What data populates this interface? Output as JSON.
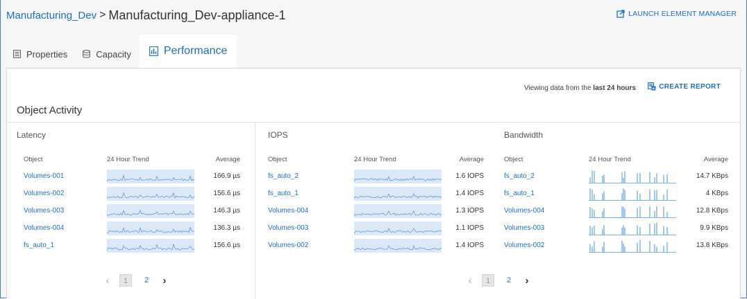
{
  "header": {
    "breadcrumb_link": "Manufacturing_Dev",
    "separator": ">",
    "title": "Manufacturing_Dev-appliance-1",
    "launch_label": "LAUNCH ELEMENT MANAGER"
  },
  "tabs": [
    {
      "label": "Properties",
      "icon": "list-icon"
    },
    {
      "label": "Capacity",
      "icon": "database-icon"
    },
    {
      "label": "Performance",
      "icon": "bar-chart-icon",
      "active": true
    }
  ],
  "toolbar": {
    "viewing_prefix": "Viewing data from the",
    "viewing_range": "last 24 hours",
    "create_report": "CREATE REPORT"
  },
  "section_title": "Object Activity",
  "colors": {
    "link": "#1e6fc6",
    "spark_bg": "#dbe8f7",
    "spark_line": "#4f8fd6",
    "bar": "#7ab0e8"
  },
  "latency": {
    "title": "Latency",
    "columns": {
      "object": "Object",
      "trend": "24 Hour Trend",
      "average": "Average"
    },
    "rows": [
      {
        "object": "Volumes-001",
        "average": "166.9 µs"
      },
      {
        "object": "Volumes-002",
        "average": "156.6 µs"
      },
      {
        "object": "Volumes-003",
        "average": "146.3 µs"
      },
      {
        "object": "Volumes-004",
        "average": "136.3 µs"
      },
      {
        "object": "fs_auto_1",
        "average": "156.6 µs"
      }
    ],
    "pagination": {
      "prev": "‹",
      "current": "1",
      "next_page": "2",
      "next": "›"
    }
  },
  "iops": {
    "title": "IOPS",
    "columns": {
      "object": "Object",
      "trend": "24 Hour Trend",
      "average": "Average"
    },
    "rows": [
      {
        "object": "fs_auto_2",
        "average": "1.6 IOPS"
      },
      {
        "object": "fs_auto_1",
        "average": "1.4 IOPS"
      },
      {
        "object": "Volumes-004",
        "average": "1.3 IOPS"
      },
      {
        "object": "Volumes-003",
        "average": "1.1 IOPS"
      },
      {
        "object": "Volumes-002",
        "average": "1.4 IOPS"
      }
    ]
  },
  "bandwidth": {
    "title": "Bandwidth",
    "columns": {
      "object": "Object",
      "trend": "24 Hour Trend",
      "average": "Average"
    },
    "rows": [
      {
        "object": "fs_auto_2",
        "average": "14.7 KBps"
      },
      {
        "object": "fs_auto_1",
        "average": "4 KBps"
      },
      {
        "object": "Volumes-004",
        "average": "12.8 KBps"
      },
      {
        "object": "Volumes-003",
        "average": "9.9 KBps"
      },
      {
        "object": "Volumes-002",
        "average": "13.8 KBps"
      }
    ],
    "pagination": {
      "prev": "‹",
      "current": "1",
      "next_page": "2",
      "next": "›"
    }
  }
}
